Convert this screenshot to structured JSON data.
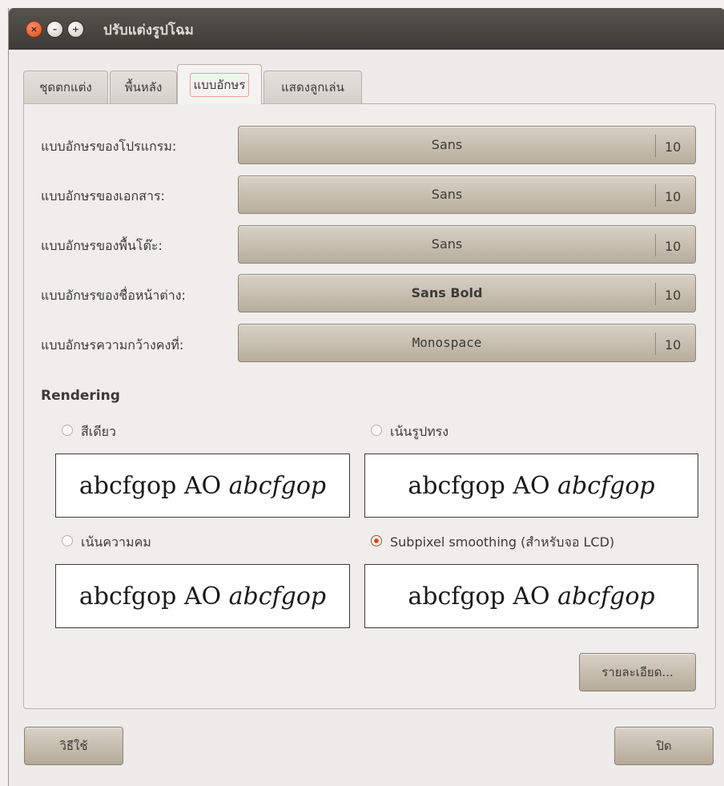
{
  "window": {
    "title": "ปรับแต่งรูปโฉม"
  },
  "window_controls": {
    "close": "×",
    "minimize": "–",
    "maximize": "+"
  },
  "tabs": [
    {
      "label": "ชุดตกแต่ง",
      "active": false
    },
    {
      "label": "พื้นหลัง",
      "active": false
    },
    {
      "label": "แบบอักษร",
      "active": true
    },
    {
      "label": "แสดงลูกเล่น",
      "active": false
    }
  ],
  "fonts": [
    {
      "label": "แบบอักษรของโปรแกรม:",
      "font": "Sans",
      "size": "10"
    },
    {
      "label": "แบบอักษรของเอกสาร:",
      "font": "Sans",
      "size": "10"
    },
    {
      "label": "แบบอักษรของพื้นโต๊ะ:",
      "font": "Sans",
      "size": "10"
    },
    {
      "label": "แบบอักษรของชื่อหน้าต่าง:",
      "font": "Sans Bold",
      "size": "10"
    },
    {
      "label": "แบบอักษรความกว้างคงที่:",
      "font": "Monospace",
      "size": "10"
    }
  ],
  "rendering": {
    "title": "Rendering",
    "options": [
      {
        "label": "สีเดียว",
        "selected": false
      },
      {
        "label": "เน้นรูปทรง",
        "selected": false
      },
      {
        "label": "เน้นความคม",
        "selected": false
      },
      {
        "label": "Subpixel smoothing (สำหรับจอ LCD)",
        "selected": true
      }
    ],
    "sample_regular": "abcfgop AO",
    "sample_italic": "abcfgop"
  },
  "buttons": {
    "details": "รายละเอียด...",
    "help": "วิธีใช้",
    "close": "ปิด"
  }
}
